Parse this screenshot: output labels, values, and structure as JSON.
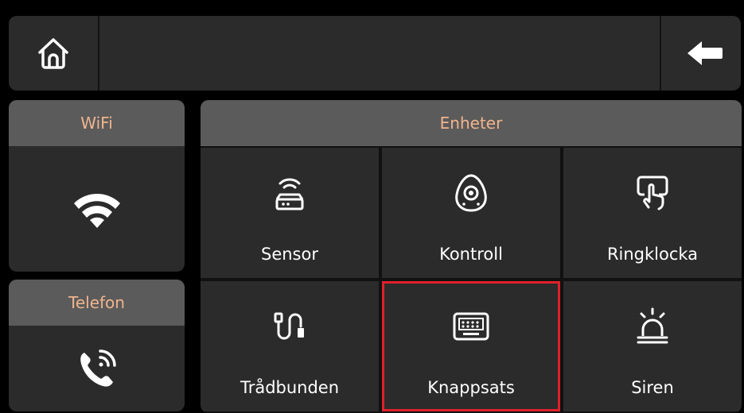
{
  "header": {
    "home_icon": "home-icon",
    "back_icon": "arrow-left-icon",
    "title": ""
  },
  "wifi": {
    "label": "WiFi",
    "icon": "wifi-icon"
  },
  "phone": {
    "label": "Telefon",
    "icon": "phone-ringing-icon"
  },
  "devices": {
    "label": "Enheter",
    "tiles": [
      {
        "label": "Sensor",
        "icon": "router-sensor-icon"
      },
      {
        "label": "Kontroll",
        "icon": "remote-fob-icon"
      },
      {
        "label": "Ringklocka",
        "icon": "doorbell-press-icon"
      },
      {
        "label": "Trådbunden",
        "icon": "wired-cable-icon"
      },
      {
        "label": "Knappsats",
        "icon": "keypad-icon",
        "selected": true
      },
      {
        "label": "Siren",
        "icon": "siren-icon"
      }
    ]
  },
  "colors": {
    "background": "#000000",
    "panel": "#2b2b2b",
    "header": "#5b5b5b",
    "header_text": "#f0b48e",
    "selection": "#e0202a"
  }
}
